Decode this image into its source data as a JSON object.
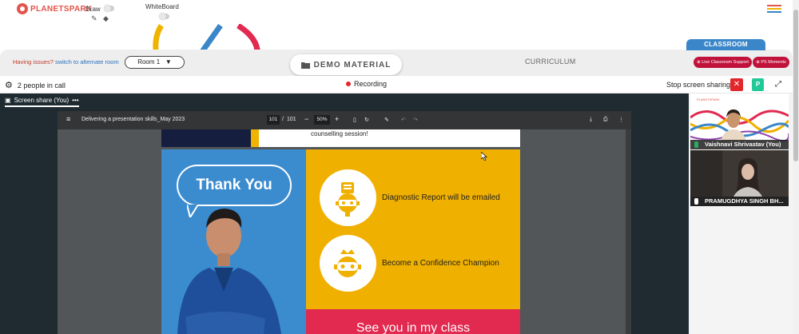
{
  "brand": {
    "logo_text": "PLANETSPARK"
  },
  "toolbar": {
    "draw_label": "Draw",
    "whiteboard_label": "WhiteBoard"
  },
  "room_bar": {
    "issues_text": "Having issues?",
    "issues_link": "switch to alternate room",
    "room_value": "Room 1",
    "room_caret": "▼",
    "demo_material": "DEMO MATERIAL",
    "curriculum": "CURRICULUM",
    "classroom_tab": "CLASSROOM",
    "live_support": "Live Classroom Support",
    "ps_moments": "PS Moments"
  },
  "call_bar": {
    "people_count": "2 people in call",
    "recording": "Recording",
    "stop_sharing": "Stop screen sharing",
    "close_icon_glyph": "✕",
    "p_button": "P",
    "expand_glyph": "⤢"
  },
  "share": {
    "tab_label": "Screen share (You)",
    "tab_menu": "•••"
  },
  "pdf": {
    "title": "Delivering a presentation skills_May 2023",
    "page_current": "101",
    "page_sep": "/",
    "page_total": "101",
    "zoom": "50%",
    "zoom_out": "−",
    "zoom_in": "+"
  },
  "slide": {
    "top_text": "counselling session!",
    "bubble_text": "Thank You",
    "item1": "Diagnostic Report will be emailed",
    "item2": "Become a Confidence Champion",
    "bottom_text": "See you in my class"
  },
  "participants": [
    {
      "name": "Vaishnavi Shrivastav (You)"
    },
    {
      "name": "PRAMUGDHYA SINGH BH..."
    }
  ],
  "colors": {
    "accent_red": "#c0123b",
    "brand_blue": "#3a86c9",
    "slide_yellow": "#f0b000",
    "slide_blue": "#3b8bcf",
    "slide_pink": "#e2294f"
  }
}
